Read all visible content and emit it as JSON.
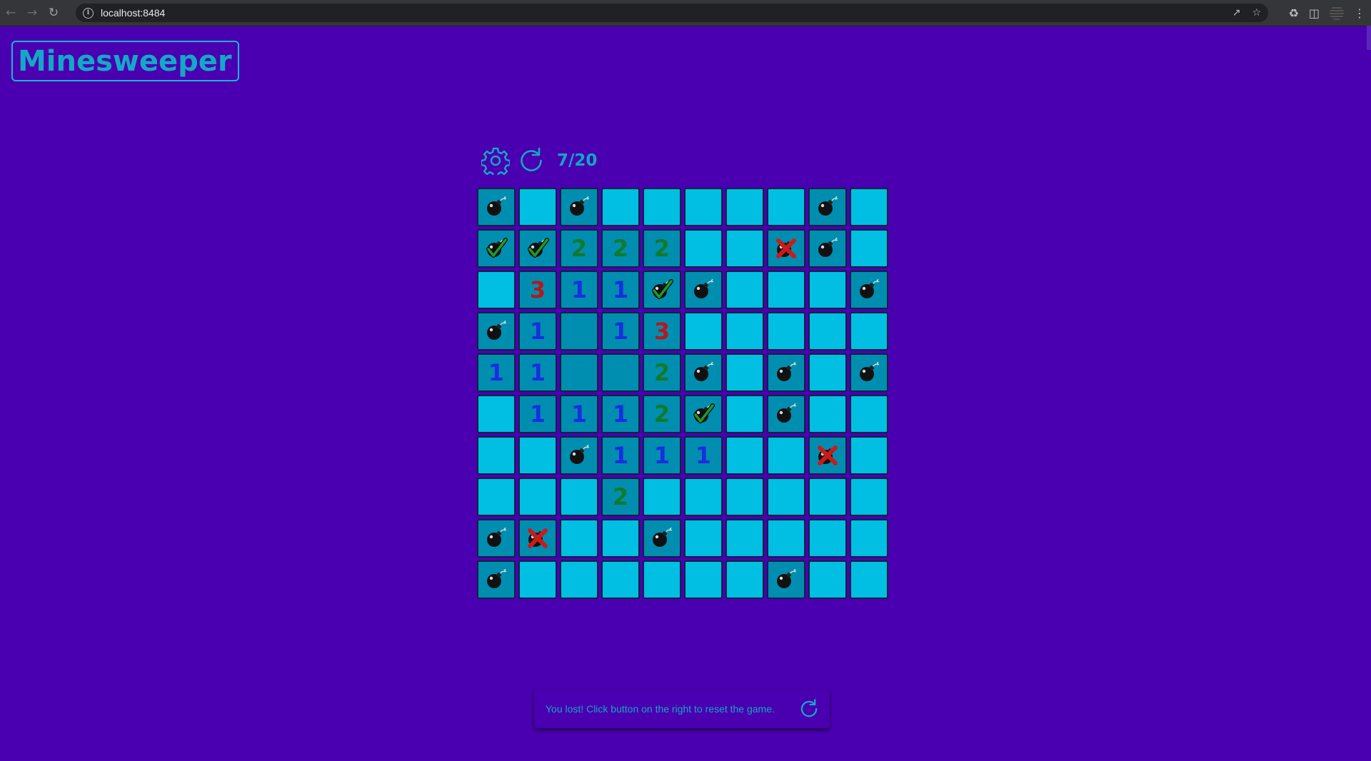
{
  "browser": {
    "url": "localhost:8484"
  },
  "app": {
    "title": "Minesweeper",
    "accent_color": "#13a8c9",
    "background_color": "#4a00b0"
  },
  "toolbar": {
    "settings_icon": "gear-icon",
    "reset_icon": "refresh-icon",
    "flag_counter": "7/20"
  },
  "board": {
    "rows": 10,
    "cols": 10,
    "cell_legend": {
      "H": "hidden",
      "O": "opened-empty",
      "B": "mine",
      "F": "correct-flag (bomb-check-icon)",
      "X": "wrong-flag (bomb-cross-icon)",
      "1-8": "opened-number"
    },
    "cells": [
      [
        "B",
        "H",
        "B",
        "H",
        "H",
        "H",
        "H",
        "H",
        "B",
        "H"
      ],
      [
        "F",
        "F",
        "2",
        "2",
        "2",
        "H",
        "H",
        "X",
        "B",
        "H"
      ],
      [
        "H",
        "3",
        "1",
        "1",
        "F",
        "B",
        "H",
        "H",
        "H",
        "B"
      ],
      [
        "B",
        "1",
        "O",
        "1",
        "3",
        "H",
        "H",
        "H",
        "H",
        "H"
      ],
      [
        "1",
        "1",
        "O",
        "O",
        "2",
        "B",
        "H",
        "B",
        "H",
        "B"
      ],
      [
        "H",
        "1",
        "1",
        "1",
        "2",
        "F",
        "H",
        "B",
        "H",
        "H"
      ],
      [
        "H",
        "H",
        "B",
        "1",
        "1",
        "1",
        "H",
        "H",
        "X",
        "H"
      ],
      [
        "H",
        "H",
        "H",
        "2",
        "H",
        "H",
        "H",
        "H",
        "H",
        "H"
      ],
      [
        "B",
        "X",
        "H",
        "H",
        "B",
        "H",
        "H",
        "H",
        "H",
        "H"
      ],
      [
        "B",
        "H",
        "H",
        "H",
        "H",
        "H",
        "H",
        "B",
        "H",
        "H"
      ]
    ],
    "colors": {
      "hidden": "#00bfe3",
      "opened": "#008eb0",
      "n1": "#1a2ee0",
      "n2": "#127a2a",
      "n3": "#b4181f"
    }
  },
  "toast": {
    "message": "You lost! Click button on the right to reset the game.",
    "action_icon": "refresh-icon"
  }
}
